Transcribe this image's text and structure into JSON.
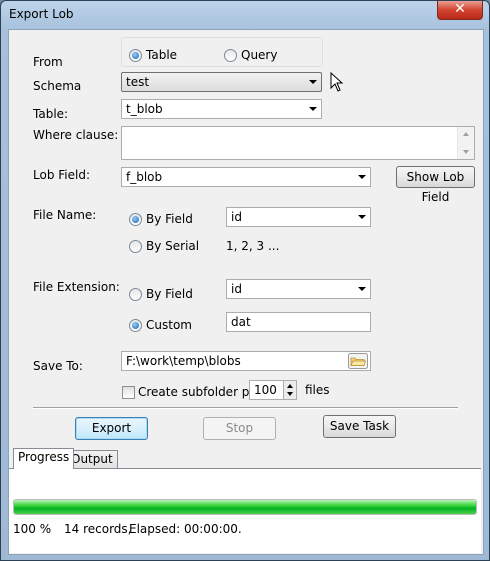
{
  "window": {
    "title": "Export Lob",
    "close_glyph": "✕"
  },
  "from": {
    "label": "From",
    "options": [
      "Table",
      "Query"
    ],
    "selected": "Table"
  },
  "schema": {
    "label": "Schema",
    "value": "test"
  },
  "table": {
    "label": "Table:",
    "value": "t_blob"
  },
  "where": {
    "label": "Where clause:",
    "value": ""
  },
  "lob_field": {
    "label": "Lob Field:",
    "value": "f_blob",
    "show_button": "Show Lob Field"
  },
  "file_name": {
    "label": "File Name:",
    "by_field_label": "By Field",
    "by_field_value": "id",
    "by_serial_label": "By Serial",
    "serial_example": "1, 2, 3 ...",
    "selected": "By Field"
  },
  "file_extension": {
    "label": "File Extension:",
    "by_field_label": "By Field",
    "by_field_value": "id",
    "custom_label": "Custom",
    "custom_value": "dat",
    "selected": "Custom"
  },
  "save_to": {
    "label": "Save To:",
    "path": "F:\\work\\temp\\blobs",
    "subfolder_label": "Create subfolder per",
    "subfolder_checked": false,
    "subfolder_count": "100",
    "files_label": "files"
  },
  "buttons": {
    "export": "Export",
    "stop": "Stop",
    "save_task": "Save Task"
  },
  "tabs": [
    {
      "label": "Progress",
      "active": true
    },
    {
      "label": "Output",
      "active": false
    }
  ],
  "progress": {
    "fraction": 1.0,
    "percent": "100 %",
    "records": "14 records,",
    "elapsed": "Elapsed: 00:00:00."
  },
  "colors": {
    "accent": "#1d5fa8",
    "progress": "#06b025",
    "title_bar": "#a7c1dc",
    "close_button": "#d2432f"
  },
  "icons": {
    "close": "close-icon",
    "folder": "folder-icon",
    "cursor": "mouse-cursor-icon"
  }
}
